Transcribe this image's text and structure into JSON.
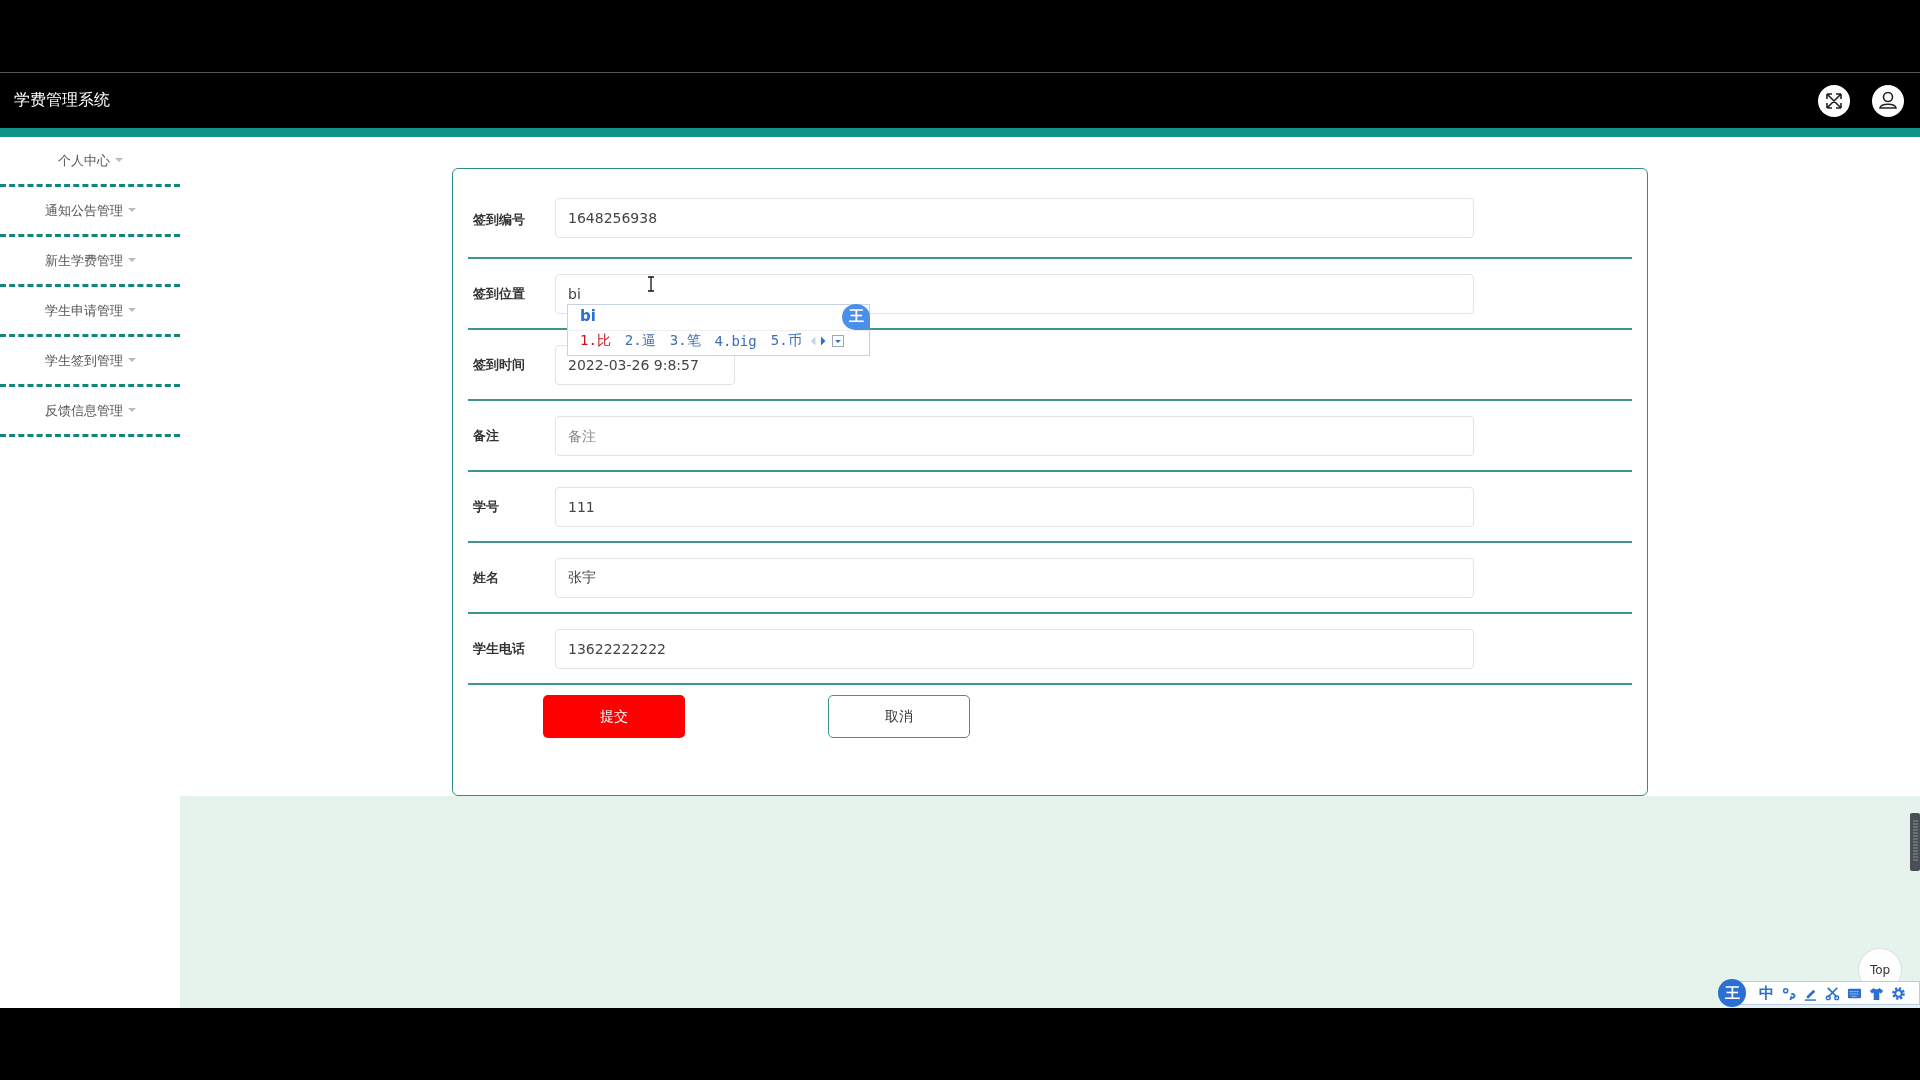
{
  "header": {
    "title": "学费管理系统"
  },
  "sidebar": {
    "items": [
      {
        "label": "个人中心"
      },
      {
        "label": "通知公告管理"
      },
      {
        "label": "新生学费管理"
      },
      {
        "label": "学生申请管理"
      },
      {
        "label": "学生签到管理"
      },
      {
        "label": "反馈信息管理"
      }
    ]
  },
  "form": {
    "fields": [
      {
        "label": "签到编号",
        "value": "1648256938",
        "kind": "text"
      },
      {
        "label": "签到位置",
        "value": "bi",
        "kind": "text"
      },
      {
        "label": "签到时间",
        "value": "2022-03-26 9:8:57",
        "kind": "date"
      },
      {
        "label": "备注",
        "placeholder": "备注",
        "kind": "text"
      },
      {
        "label": "学号",
        "value": "111",
        "kind": "text"
      },
      {
        "label": "姓名",
        "value": "张宇",
        "kind": "text"
      },
      {
        "label": "学生电话",
        "value": "13622222222",
        "kind": "text"
      }
    ],
    "buttons": [
      {
        "label": "提交",
        "kind": "primary"
      },
      {
        "label": "取消",
        "kind": "secondary"
      }
    ]
  },
  "ime_popup": {
    "composition": "bi",
    "logo": "王",
    "candidates": [
      {
        "label": "1.比",
        "selected": true
      },
      {
        "label": "2.逼",
        "selected": false
      },
      {
        "label": "3.笔",
        "selected": false
      },
      {
        "label": "4.big",
        "selected": false
      },
      {
        "label": "5.币",
        "selected": false
      }
    ]
  },
  "back_to_top": "Top",
  "ime_toolbar": {
    "logo": "王",
    "mode": "中"
  }
}
